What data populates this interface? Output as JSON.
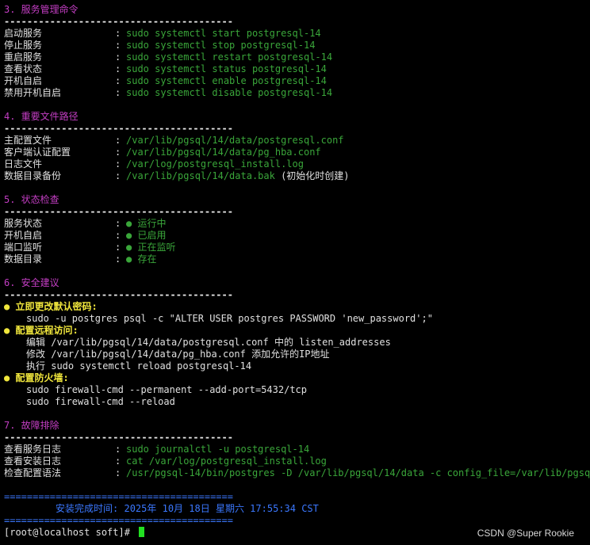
{
  "sec3": {
    "title": "3. 服务管理命令",
    "rule": "----------------------------------------",
    "rows": [
      {
        "k": "启动服务",
        "sep": ":",
        "v": "sudo systemctl start postgresql-14"
      },
      {
        "k": "停止服务",
        "sep": ":",
        "v": "sudo systemctl stop postgresql-14"
      },
      {
        "k": "重启服务",
        "sep": ":",
        "v": "sudo systemctl restart postgresql-14"
      },
      {
        "k": "查看状态",
        "sep": ":",
        "v": "sudo systemctl status postgresql-14"
      },
      {
        "k": "开机自启",
        "sep": ":",
        "v": "sudo systemctl enable postgresql-14"
      },
      {
        "k": "禁用开机自启",
        "sep": ":",
        "v": "sudo systemctl disable postgresql-14"
      }
    ]
  },
  "sec4": {
    "title": "4. 重要文件路径",
    "rule": "----------------------------------------",
    "rows": [
      {
        "k": "主配置文件",
        "sep": ":",
        "v": "/var/lib/pgsql/14/data/postgresql.conf"
      },
      {
        "k": "客户端认证配置",
        "sep": ":",
        "v": "/var/lib/pgsql/14/data/pg_hba.conf"
      },
      {
        "k": "日志文件",
        "sep": ":",
        "v": "/var/log/postgresql_install.log"
      },
      {
        "k": "数据目录备份",
        "sep": ":",
        "v": "/var/lib/pgsql/14/data.bak",
        "note": " (初始化时创建)"
      }
    ]
  },
  "sec5": {
    "title": "5. 状态检查",
    "rule": "----------------------------------------",
    "rows": [
      {
        "k": "服务状态",
        "sep": ":",
        "v": "● 运行中"
      },
      {
        "k": "开机自启",
        "sep": ":",
        "v": "● 已启用"
      },
      {
        "k": "端口监听",
        "sep": ":",
        "v": "● 正在监听"
      },
      {
        "k": "数据目录",
        "sep": ":",
        "v": "● 存在"
      }
    ]
  },
  "sec6": {
    "title": "6. 安全建议",
    "rule": "----------------------------------------",
    "b1": "● 立即更改默认密码:",
    "b1_cmd": "sudo -u postgres psql -c \"ALTER USER postgres PASSWORD 'new_password';\"",
    "b2": "● 配置远程访问:",
    "b2_l1": "编辑 /var/lib/pgsql/14/data/postgresql.conf 中的 listen_addresses",
    "b2_l2": "修改 /var/lib/pgsql/14/data/pg_hba.conf 添加允许的IP地址",
    "b2_l3": "执行 sudo systemctl reload postgresql-14",
    "b3": "● 配置防火墙:",
    "b3_l1": "sudo firewall-cmd --permanent --add-port=5432/tcp",
    "b3_l2": "sudo firewall-cmd --reload"
  },
  "sec7": {
    "title": "7. 故障排除",
    "rule": "----------------------------------------",
    "rows": [
      {
        "k": "查看服务日志",
        "sep": ":",
        "v": "sudo journalctl -u postgresql-14"
      },
      {
        "k": "查看安装日志",
        "sep": ":",
        "v": "cat /var/log/postgresql_install.log"
      },
      {
        "k": "检查配置语法",
        "sep": ":",
        "v": "/usr/pgsql-14/bin/postgres -D /var/lib/pgsql/14/data -c config_file=/var/lib/pgsql/1"
      }
    ]
  },
  "footer": {
    "rule": "========================================",
    "install_time": "         安装完成时间: 2025年 10月 18日 星期六 17:55:34 CST"
  },
  "prompt": "[root@localhost soft]# ",
  "watermark": "CSDN @Super Rookie",
  "colors": {
    "section_title": "#c33ec3",
    "value_green": "#3aa63a",
    "bullet_yellow": "#f0e63c",
    "footer_blue": "#3b78ff",
    "cursor_green": "#22e022"
  }
}
